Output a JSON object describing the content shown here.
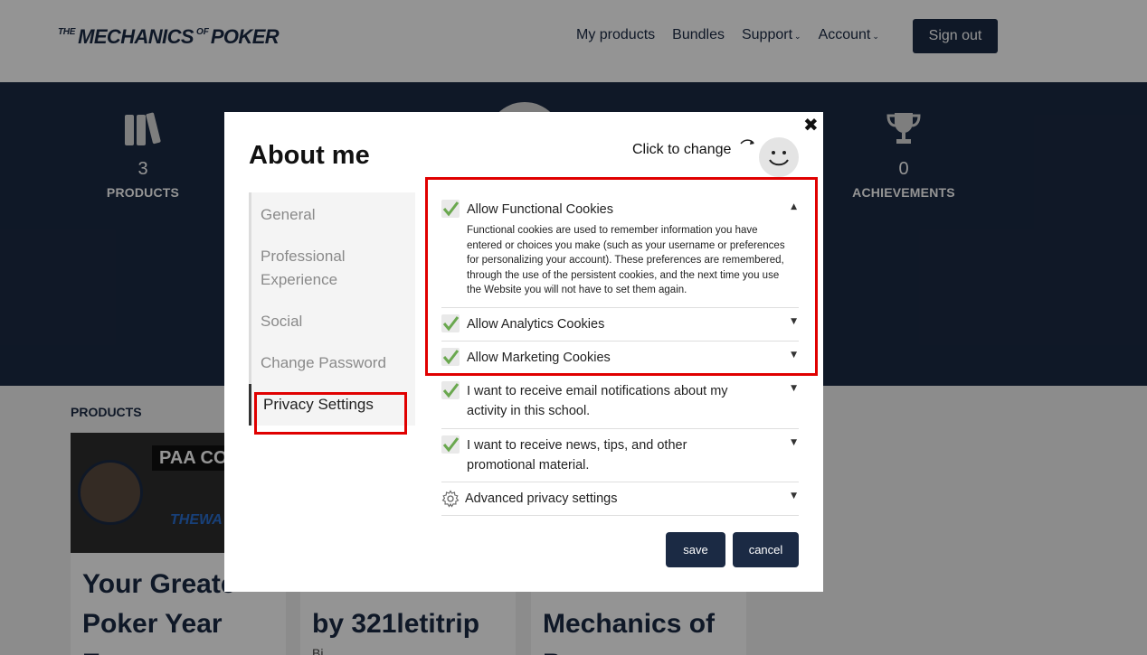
{
  "header": {
    "logo": {
      "the": "THE",
      "mechanics": "MECHANICS",
      "of": "OF",
      "poker": "POKER"
    },
    "nav": [
      {
        "label": "My products",
        "caret": false
      },
      {
        "label": "Bundles",
        "caret": false
      },
      {
        "label": "Support",
        "caret": true
      },
      {
        "label": "Account",
        "caret": true
      }
    ],
    "sign_out_label": "Sign out"
  },
  "stats": {
    "products": {
      "value": "3",
      "label": "PRODUCTS",
      "icon": "books-icon"
    },
    "achievements": {
      "value": "0",
      "label": "ACHIEVEMENTS",
      "icon": "trophy-icon"
    }
  },
  "products_section": {
    "label": "PRODUCTS",
    "cards": [
      {
        "banner": "PAA CO",
        "banner2": "THEWA",
        "title_lines": [
          "Your Greate",
          "Poker Year",
          "E"
        ]
      },
      {
        "title_lines": [
          "",
          "by 321letitrip",
          "Bi..."
        ]
      },
      {
        "title_lines": [
          "",
          "Mechanics of",
          "P..."
        ]
      }
    ]
  },
  "modal": {
    "title": "About me",
    "click_to_change": "Click to change",
    "menu": [
      {
        "label": "General",
        "active": false
      },
      {
        "label": "Professional Experience",
        "active": false
      },
      {
        "label": "Social",
        "active": false
      },
      {
        "label": "Change Password",
        "active": false
      },
      {
        "label": "Privacy Settings",
        "active": true
      }
    ],
    "settings": [
      {
        "label": "Allow Functional Cookies",
        "checked": true,
        "expanded": true,
        "description": "Functional cookies are used to remember information you have entered or choices you make (such as your username or preferences for personalizing your account). These preferences are remembered, through the use of the persistent cookies, and the next time you use the Website you will not have to set them again."
      },
      {
        "label": "Allow Analytics Cookies",
        "checked": true,
        "expanded": false
      },
      {
        "label": "Allow Marketing Cookies",
        "checked": true,
        "expanded": false
      },
      {
        "label": "I want to receive email notifications about my activity in this school.",
        "checked": true,
        "expanded": false
      },
      {
        "label": "I want to receive news, tips, and other promotional material.",
        "checked": true,
        "expanded": false
      },
      {
        "label": "Advanced privacy settings",
        "icon": "gear-icon",
        "expanded": false
      }
    ],
    "save_label": "save",
    "cancel_label": "cancel"
  },
  "colors": {
    "navy": "#1b2a44",
    "highlight_red": "#e00000",
    "check_green": "#6aa84f",
    "overlay": "rgba(0,0,0,0.42)"
  }
}
